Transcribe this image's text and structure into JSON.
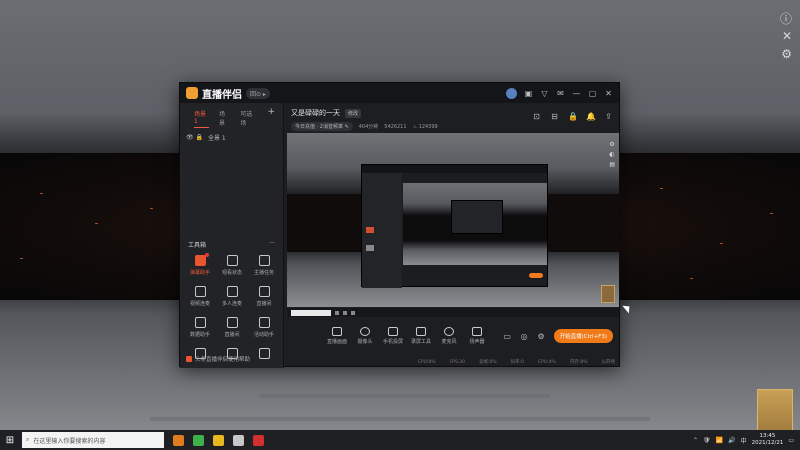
{
  "desktop": {
    "right_controls": [
      "ⓘ",
      "✕",
      "⚙"
    ]
  },
  "app": {
    "name": "直播伴侣",
    "version_badge": "回⊙ ▸",
    "title_icons": [
      "◉",
      "▣",
      "▽",
      "✉",
      "—",
      "▢",
      "✕"
    ]
  },
  "sidebar": {
    "tabs": [
      "场景1",
      "场景",
      "可选场"
    ],
    "active_tab": "场景1",
    "scene_row": {
      "left_icons": "👁 🔒",
      "label": "全景 1"
    },
    "tool_header": {
      "label": "工具箱",
      "more": "···"
    },
    "tools": [
      {
        "label": "弹幕助手",
        "hot": true,
        "badge": "dot"
      },
      {
        "label": "观看状态",
        "hot": false
      },
      {
        "label": "主播任务",
        "hot": false
      },
      {
        "label": "视频连麦",
        "hot": false,
        "badge": "new"
      },
      {
        "label": "多人连麦",
        "hot": false
      },
      {
        "label": "直播间",
        "hot": false
      },
      {
        "label": "数据助手",
        "hot": false
      },
      {
        "label": "直播间",
        "hot": false
      },
      {
        "label": "活动助手",
        "hot": false
      },
      {
        "label": "",
        "hot": false
      },
      {
        "label": "",
        "hot": false
      },
      {
        "label": "",
        "hot": false
      }
    ],
    "footer": "头条直播伴侣使用帮助"
  },
  "live": {
    "title": "又是碌碌的一天",
    "edit_label": "修改",
    "meta": [
      "今日充值 · 2消音频率 ✎",
      "404分钟",
      "5426211",
      "♨ 124399"
    ],
    "header_icons": [
      "⊡",
      "⊟",
      "🔒",
      "🔔",
      "⇪"
    ]
  },
  "preview": {
    "side_icons": [
      "⚙",
      "◐",
      "▤"
    ]
  },
  "toolbar": {
    "items": [
      "直播画面",
      "摄像头",
      "手机投屏",
      "录屏工具",
      "麦克风",
      "扬声器"
    ],
    "right_icons": [
      "▭",
      "◎",
      "⚙"
    ],
    "start_button": "开始直播(Ctrl+F3)"
  },
  "status_bar": [
    "CPU:8%",
    "FPS:30",
    "丢帧:0%",
    "码率:0",
    "CPU:4%",
    "内存:8%",
    "公开场"
  ],
  "taskbar": {
    "search_placeholder": "在这里输入你要搜索的内容",
    "apps": [
      {
        "color": "#e07b20"
      },
      {
        "color": "#3db14a"
      },
      {
        "color": "#e8b820"
      },
      {
        "color": "#c7c7c7"
      },
      {
        "color": "#d23030"
      }
    ],
    "tray_icons": [
      "⌃",
      "🛡",
      "📶",
      "🔊",
      "中"
    ],
    "time": "13:45",
    "date": "2021/12/21"
  }
}
